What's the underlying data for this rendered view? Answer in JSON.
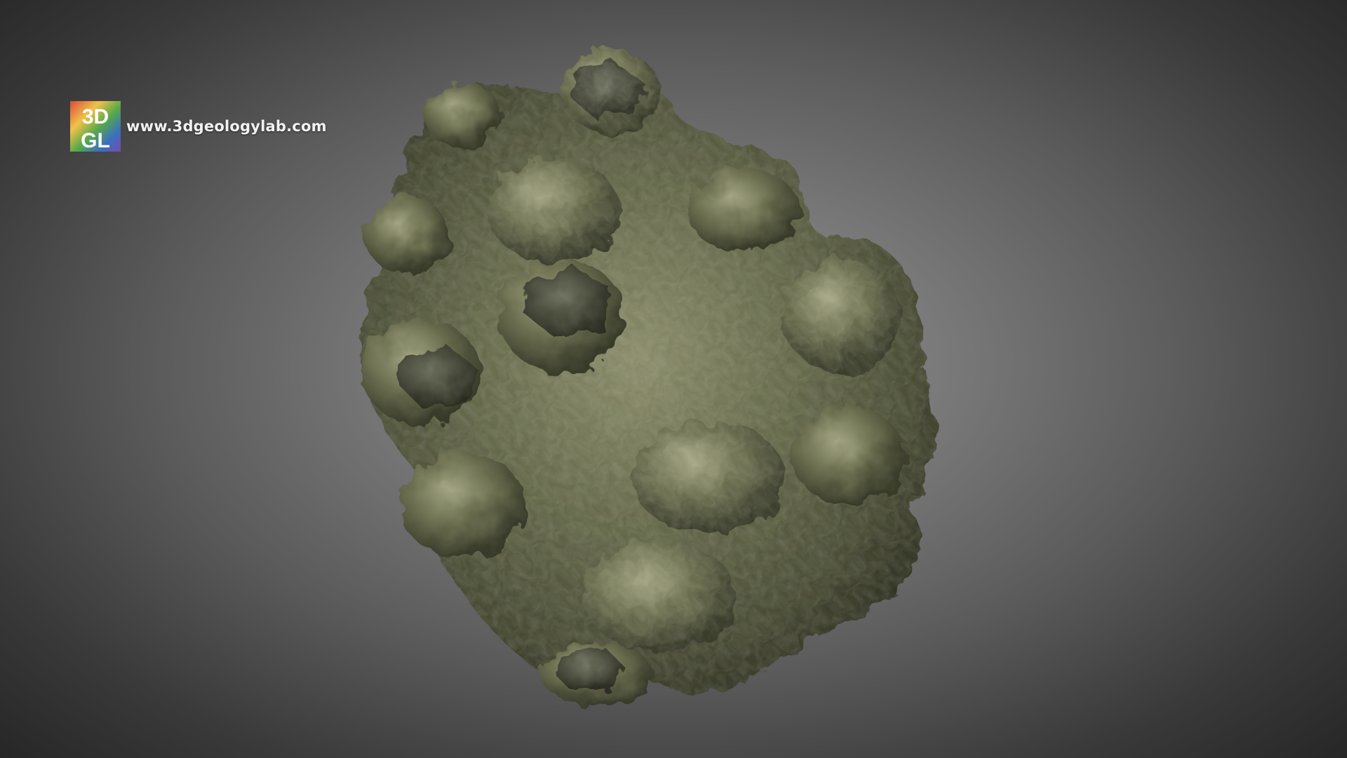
{
  "watermark": {
    "logo_line1": "3D",
    "logo_line2": "GL",
    "site_url": "www.3dgeologylab.com"
  },
  "colors": {
    "background_center": "#8e8e8e",
    "background_edge": "#262626",
    "rock_base": "#5b5e43",
    "rock_highlight": "#9ea07e",
    "rock_shadow": "#2f3123",
    "logo_top": "#d64b3a",
    "logo_mid": "#f2c14a",
    "logo_green": "#55a84a",
    "logo_blue": "#3a6fc2",
    "logo_purple": "#7a4aa8"
  },
  "icons": {
    "logo": "3dgl-logo-icon"
  }
}
